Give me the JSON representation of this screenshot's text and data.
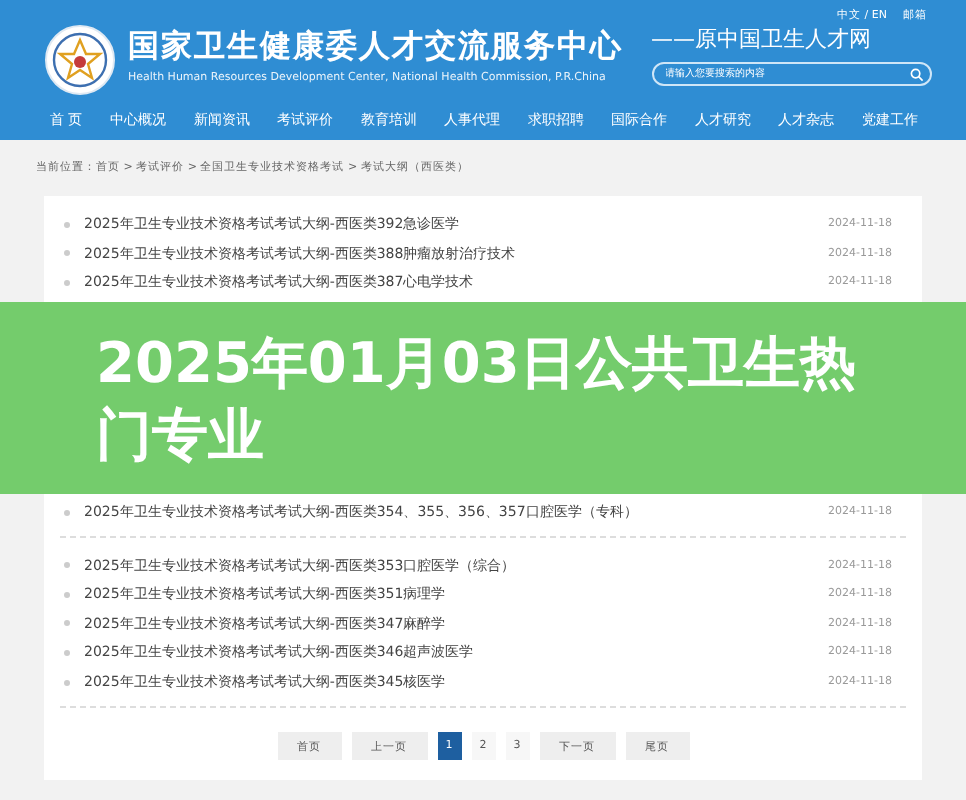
{
  "header": {
    "title": "国家卫生健康委人才交流服务中心",
    "subtitle": "Health Human Resources Development Center, National Health Commission, P.R.China",
    "former_name": "——原中国卫生人才网",
    "top_links": [
      "中文 / EN",
      "邮箱"
    ],
    "search": {
      "placeholder": "请输入您要搜索的内容"
    },
    "nav": [
      "首 页",
      "中心概况",
      "新闻资讯",
      "考试评价",
      "教育培训",
      "人事代理",
      "求职招聘",
      "国际合作",
      "人才研究",
      "人才杂志",
      "党建工作"
    ]
  },
  "breadcrumb": "当前位置：首页 > 考试评价 > 全国卫生专业技术资格考试 > 考试大纲（西医类）",
  "groups": [
    [
      {
        "title": "2025年卫生专业技术资格考试考试大纲-西医类392急诊医学",
        "date": "2024-11-18"
      },
      {
        "title": "2025年卫生专业技术资格考试考试大纲-西医类388肿瘤放射治疗技术",
        "date": "2024-11-18"
      },
      {
        "title": "2025年卫生专业技术资格考试考试大纲-西医类387心电学技术",
        "date": "2024-11-18"
      }
    ],
    [
      {
        "title": "2025年卫生专业技术资格考试考试大纲-西医类354、355、356、357口腔医学（专科）",
        "date": "2024-11-18"
      }
    ],
    [
      {
        "title": "2025年卫生专业技术资格考试考试大纲-西医类353口腔医学（综合）",
        "date": "2024-11-18"
      },
      {
        "title": "2025年卫生专业技术资格考试考试大纲-西医类351病理学",
        "date": "2024-11-18"
      },
      {
        "title": "2025年卫生专业技术资格考试考试大纲-西医类347麻醉学",
        "date": "2024-11-18"
      },
      {
        "title": "2025年卫生专业技术资格考试考试大纲-西医类346超声波医学",
        "date": "2024-11-18"
      },
      {
        "title": "2025年卫生专业技术资格考试考试大纲-西医类345核医学",
        "date": "2024-11-18"
      }
    ]
  ],
  "pager": [
    {
      "label": "首页",
      "kind": "nav",
      "selected": false
    },
    {
      "label": "上一页",
      "kind": "nav",
      "selected": false
    },
    {
      "label": "1",
      "kind": "page",
      "selected": true
    },
    {
      "label": "2",
      "kind": "page",
      "selected": false
    },
    {
      "label": "3",
      "kind": "page",
      "selected": false
    },
    {
      "label": "下一页",
      "kind": "nav",
      "selected": false
    },
    {
      "label": "尾页",
      "kind": "nav",
      "selected": false
    }
  ],
  "banner": {
    "headline": "2025年01月03日公共卫生热门专业"
  }
}
